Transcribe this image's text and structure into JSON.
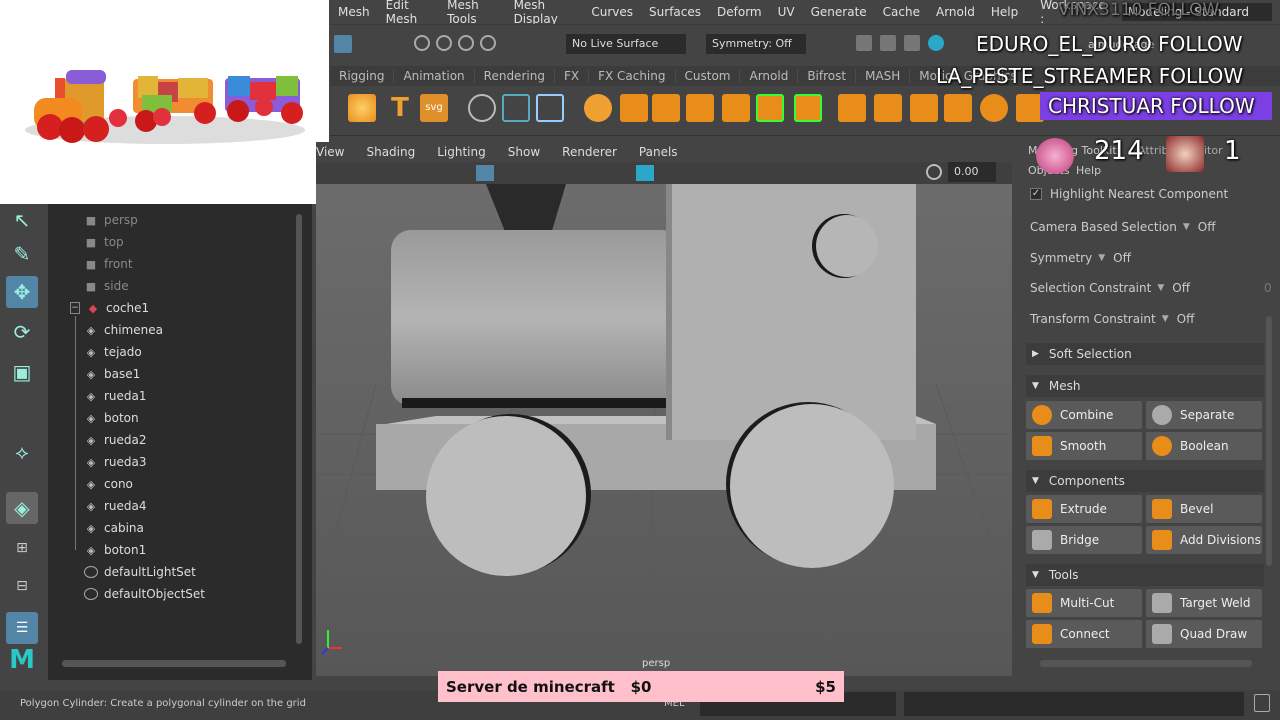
{
  "menu": [
    "Mesh",
    "Edit Mesh",
    "Mesh Tools",
    "Mesh Display",
    "Curves",
    "Surfaces",
    "Deform",
    "UV",
    "Generate",
    "Cache",
    "Arnold",
    "Help"
  ],
  "workspace": {
    "label": "Workspace :",
    "value": "Modeling - Standard"
  },
  "status": {
    "live_surface": "No Live Surface",
    "symmetry": "Symmetry: Off",
    "user": "almuderage"
  },
  "shelf_tabs": [
    "Rigging",
    "Animation",
    "Rendering",
    "FX",
    "FX Caching",
    "Custom",
    "Arnold",
    "Bifrost",
    "MASH",
    "Motion Graphics"
  ],
  "outliner": {
    "cameras": [
      "persp",
      "top",
      "front",
      "side"
    ],
    "group": "coche1",
    "children": [
      "chimenea",
      "tejado",
      "base1",
      "rueda1",
      "boton",
      "rueda2",
      "rueda3",
      "cono",
      "rueda4",
      "cabina",
      "boton1"
    ],
    "sets": [
      "defaultLightSet",
      "defaultObjectSet"
    ]
  },
  "viewport": {
    "menu": [
      "View",
      "Shading",
      "Lighting",
      "Show",
      "Renderer",
      "Panels"
    ],
    "value": "0.00",
    "camera_label": "persp"
  },
  "right_panel": {
    "tabs": [
      "Modeling Toolkit",
      "Attribute Editor"
    ],
    "submenu": [
      "Objects",
      "Help"
    ],
    "highlight": "Highlight Nearest Component",
    "rows": [
      {
        "label": "Camera Based Selection",
        "value": "Off"
      },
      {
        "label": "Symmetry",
        "value": "Off"
      },
      {
        "label": "Selection Constraint",
        "value": "Off",
        "extra": "0"
      },
      {
        "label": "Transform Constraint",
        "value": "Off"
      }
    ],
    "soft_selection": "Soft Selection",
    "sections": [
      {
        "name": "Mesh",
        "buttons": [
          "Combine",
          "Separate",
          "Smooth",
          "Boolean"
        ]
      },
      {
        "name": "Components",
        "buttons": [
          "Extrude",
          "Bevel",
          "Bridge",
          "Add Divisions"
        ]
      },
      {
        "name": "Tools",
        "buttons": [
          "Multi-Cut",
          "Target Weld",
          "Connect",
          "Quad Draw"
        ]
      }
    ]
  },
  "statusbar": {
    "help": "Polygon Cylinder: Create a polygonal cylinder on the grid",
    "mel": "MEL"
  },
  "overlay": {
    "top_text": "VINX3110  FOLLOW",
    "line2": "EDURO_EL_DURO  FOLLOW",
    "line3": "LA_PESTE_STREAMER  FOLLOW",
    "line4": "CHRISTUAR  FOLLOW",
    "count1": "214",
    "count2": "1",
    "donation_title": "Server de minecraft",
    "donation_current": "$0",
    "donation_goal": "$5"
  },
  "colors": {
    "accent": "#7b3fe4",
    "maya_bg": "#444444",
    "highlight_btn": "#5285a6"
  }
}
